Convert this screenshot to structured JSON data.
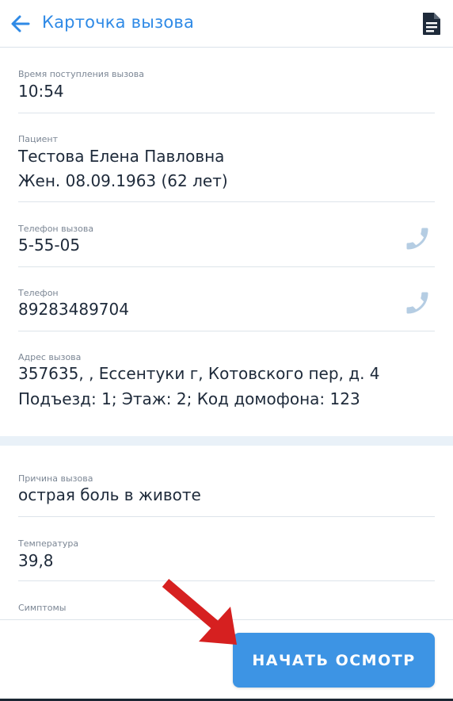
{
  "header": {
    "title": "Карточка вызова",
    "back_icon": "arrow-left-icon",
    "doc_icon": "document-icon"
  },
  "fields": {
    "time": {
      "label": "Время поступления вызова",
      "value": "10:54"
    },
    "patient": {
      "label": "Пациент",
      "name": "Тестова Елена Павловна",
      "details": "Жен. 08.09.1963 (62 лет)"
    },
    "call_phone": {
      "label": "Телефон вызова",
      "value": "5-55-05",
      "icon": "phone-icon"
    },
    "phone": {
      "label": "Телефон",
      "value": "89283489704",
      "icon": "phone-icon"
    },
    "address": {
      "label": "Адрес вызова",
      "line1": "357635, , Ессентуки г, Котовского пер, д. 4",
      "line2": "Подъезд: 1; Этаж: 2; Код домофона: 123"
    },
    "reason": {
      "label": "Причина вызова",
      "value": "острая боль в животе"
    },
    "temperature": {
      "label": "Температура",
      "value": "39,8"
    },
    "symptoms": {
      "label": "Симптомы"
    }
  },
  "actions": {
    "start_label": "НАЧАТЬ ОСМОТР"
  },
  "colors": {
    "accent": "#2f8ae6",
    "button": "#3d94e4",
    "annotation_arrow": "#d62020"
  }
}
